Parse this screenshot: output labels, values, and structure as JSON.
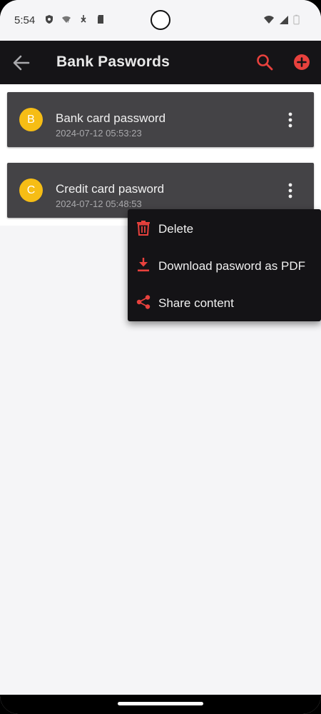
{
  "status_bar": {
    "time": "5:54",
    "icons_left": [
      "shield-icon",
      "wifi-question-icon",
      "download-arrow-icon",
      "sd-card-icon"
    ],
    "icons_right": [
      "wifi-icon",
      "signal-icon",
      "battery-icon"
    ]
  },
  "app_bar": {
    "title": "Bank Paswords",
    "icons": {
      "back": "arrow-left-icon",
      "search": "search-icon",
      "add": "add-circle-icon"
    },
    "accent": "#e8413d"
  },
  "items": [
    {
      "initial": "B",
      "title": "Bank card password",
      "date": "2024-07-12 05:53:23"
    },
    {
      "initial": "C",
      "title": "Credit card pasword",
      "date": "2024-07-12 05:48:53"
    }
  ],
  "menu": {
    "items": [
      {
        "label": "Delete",
        "icon": "trash-icon"
      },
      {
        "label": "Download pasword as PDF",
        "icon": "download-icon"
      },
      {
        "label": "Share content",
        "icon": "share-icon"
      }
    ]
  },
  "colors": {
    "avatar": "#f6bd15",
    "card": "#444346",
    "menu": "#141316",
    "app_bar": "#151417"
  }
}
